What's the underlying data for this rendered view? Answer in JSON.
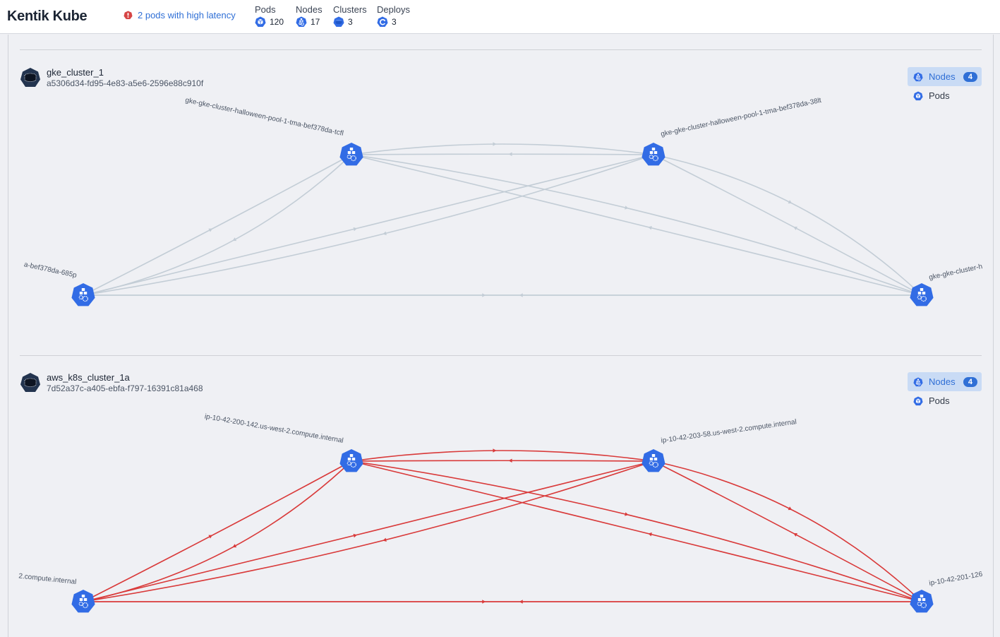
{
  "header": {
    "title": "Kentik Kube",
    "alert": {
      "icon": "warning-octagon-icon",
      "text": "2 pods with high latency",
      "color": "#d64545"
    },
    "stats": [
      {
        "label": "Pods",
        "value": "120",
        "icon": "pod-icon"
      },
      {
        "label": "Nodes",
        "value": "17",
        "icon": "node-icon"
      },
      {
        "label": "Clusters",
        "value": "3",
        "icon": "cluster-icon"
      },
      {
        "label": "Deploys",
        "value": "3",
        "icon": "deploy-icon"
      }
    ]
  },
  "colors": {
    "accent": "#2f6fd6",
    "node": "#326ce5",
    "edge_normal": "#c3cdd6",
    "edge_latency": "#d93a3a",
    "cluster_icon": "#23344f"
  },
  "clusters": [
    {
      "name": "gke_cluster_1",
      "id": "a5306d34-fd95-4e83-a5e6-2596e88c910f",
      "status": "normal",
      "view": {
        "nodes_label": "Nodes",
        "nodes_count": "4",
        "pods_label": "Pods",
        "active": "nodes"
      },
      "nodes": [
        {
          "label": "gke-gke-cluster-halloween-pool-1-tma-bef378da-tcfl"
        },
        {
          "label": "gke-gke-cluster-halloween-pool-1-tma-bef378da-38lt"
        },
        {
          "label": "a-bef378da-685p"
        },
        {
          "label": "gke-gke-cluster-h"
        }
      ]
    },
    {
      "name": "aws_k8s_cluster_1a",
      "id": "7d52a37c-a405-ebfa-f797-16391c81a468",
      "status": "latency",
      "view": {
        "nodes_label": "Nodes",
        "nodes_count": "4",
        "pods_label": "Pods",
        "active": "nodes"
      },
      "nodes": [
        {
          "label": "ip-10-42-200-142.us-west-2.compute.internal"
        },
        {
          "label": "ip-10-42-203-58.us-west-2.compute.internal"
        },
        {
          "label": "2.compute.internal"
        },
        {
          "label": "ip-10-42-201-126"
        }
      ]
    }
  ]
}
